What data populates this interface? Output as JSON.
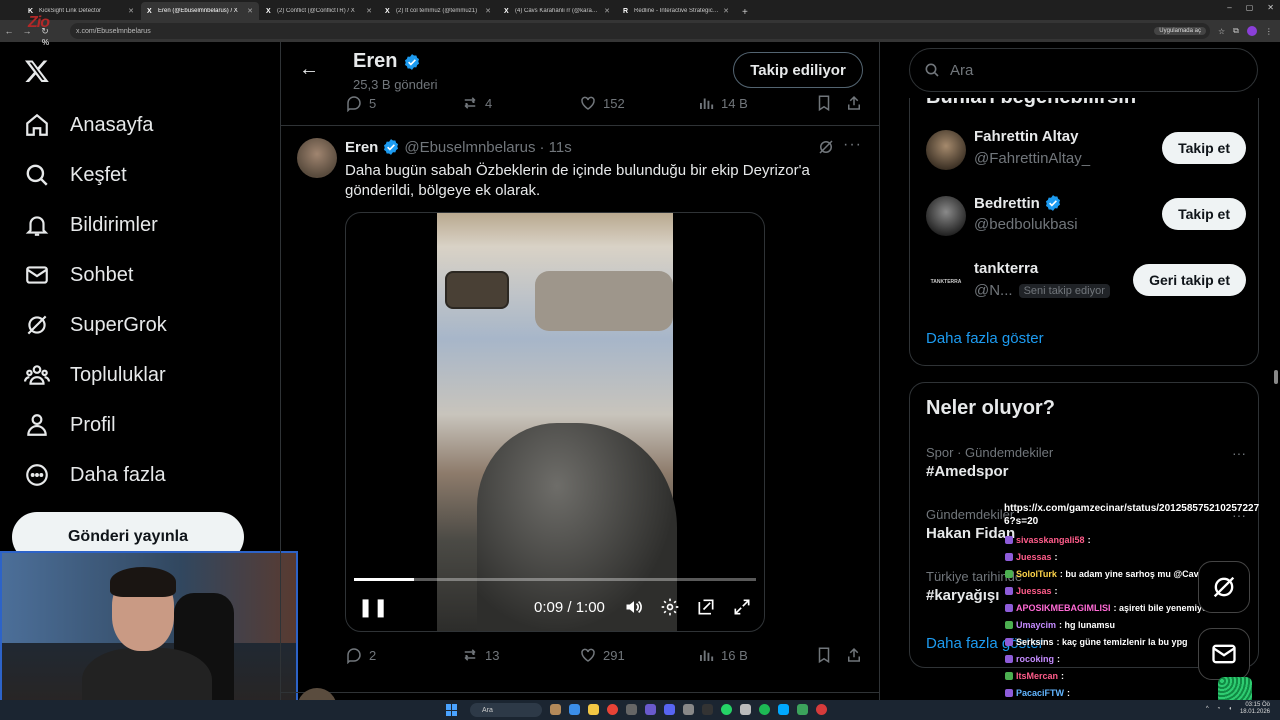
{
  "browser": {
    "tabs": [
      {
        "label": "KickSight Link Detector",
        "fav": "K"
      },
      {
        "label": "Eren (@Ebuselmnbelarus) / X",
        "fav": "X",
        "active": true
      },
      {
        "label": "(2) Conflict (@ConflictTR) / X",
        "fav": "X"
      },
      {
        "label": "(2) It col temmuz (@temmuz1)",
        "fav": "X"
      },
      {
        "label": "(4) Cävs Karahänli rr (@karahan",
        "fav": "X"
      },
      {
        "label": "Redline - Interactive Strategic M",
        "fav": "R"
      }
    ],
    "url": "x.com/Ebuselmnbelarus",
    "app_chip": "Uygulamada aç",
    "overlay_logo": "Zio",
    "overlay_pct": "%"
  },
  "nav": {
    "items": [
      {
        "label": "Anasayfa",
        "icon": "home-icon"
      },
      {
        "label": "Keşfet",
        "icon": "search-icon"
      },
      {
        "label": "Bildirimler",
        "icon": "bell-icon"
      },
      {
        "label": "Sohbet",
        "icon": "mail-icon"
      },
      {
        "label": "SuperGrok",
        "icon": "grok-icon"
      },
      {
        "label": "Topluluklar",
        "icon": "people-icon"
      },
      {
        "label": "Profil",
        "icon": "person-icon"
      },
      {
        "label": "Daha fazla",
        "icon": "more-circle-icon"
      }
    ],
    "post_button": "Gönderi yayınla"
  },
  "header": {
    "name": "Eren",
    "post_count": "25,3 B gönderi",
    "follow_button": "Takip ediliyor"
  },
  "prev_post_actions": {
    "replies": "5",
    "reposts": "4",
    "likes": "152",
    "views": "14 B"
  },
  "post": {
    "name": "Eren",
    "handle": "@Ebuselmnbelarus",
    "time": "· 11s",
    "text": "Daha bugün sabah Özbeklerin de içinde bulunduğu bir ekip Deyrizor'a gönderildi, bölgeye ek olarak.",
    "video": {
      "time": "0:09 / 1:00",
      "progress": 0.15
    },
    "actions": {
      "replies": "2",
      "reposts": "13",
      "likes": "291",
      "views": "16 B"
    }
  },
  "right": {
    "search_placeholder": "Ara",
    "who_title": "Bunları beğenebilirsin",
    "who": [
      {
        "name": "Fahrettin Altay",
        "handle": "@FahrettinAltay_",
        "verified": false,
        "button": "Takip et"
      },
      {
        "name": "Bedrettin",
        "handle": "@bedbolukbasi",
        "verified": true,
        "button": "Takip et"
      },
      {
        "name": "tankterra",
        "handle": "@N...",
        "badge": "Seni takip ediyor",
        "button": "Geri takip et",
        "logo_text": "TANKTERRA"
      }
    ],
    "show_more": "Daha fazla göster",
    "trends_title": "Neler oluyor?",
    "trends": [
      {
        "category": "Spor · Gündemdekiler",
        "topic": "#Amedspor"
      },
      {
        "category": "Gündemdekiler",
        "topic": "Hakan Fidan"
      },
      {
        "category": "Türkiye tarihinde",
        "topic": "#karyağışı"
      }
    ],
    "trends_more": "Daha fazla göster"
  },
  "chat": {
    "url_line": "https://x.com/gamzecinar/status/2012585752102572276?s=20",
    "messages": [
      {
        "user": "sivasskangali58",
        "text": ":",
        "color": "#ff5c8a"
      },
      {
        "user": "Juessas",
        "text": ":",
        "color": "#ff5c8a"
      },
      {
        "user": "SololTurk",
        "text": ": bu adam yine sarhoş mu @Cavs",
        "color": "#ffd54a"
      },
      {
        "user": "Juessas",
        "text": ":",
        "color": "#ff5c8a"
      },
      {
        "user": "APOSIKMEBAGIMLISI",
        "text": ": aşireti bile yenemiyorlar amk",
        "color": "#ff6ad5"
      },
      {
        "user": "Umaycim",
        "text": ": hg lunamsu",
        "color": "#c58bff"
      },
      {
        "user": "Serksins",
        "text": ": kaç güne temizlenir la bu ypg",
        "color": "#ffffff"
      },
      {
        "user": "rocoking",
        "text": ":",
        "color": "#c58bff"
      },
      {
        "user": "ItsMercan",
        "text": ":",
        "color": "#ff5c8a"
      },
      {
        "user": "PacaciFTW",
        "text": ":",
        "color": "#62b5ff"
      }
    ]
  },
  "taskbar": {
    "search": "Ara",
    "time": "03:15 Öö",
    "date": "18.01.2026"
  },
  "colors": {
    "accent": "#1d9bf0",
    "background": "#000000",
    "border": "#2f3336",
    "muted": "#71767b"
  }
}
